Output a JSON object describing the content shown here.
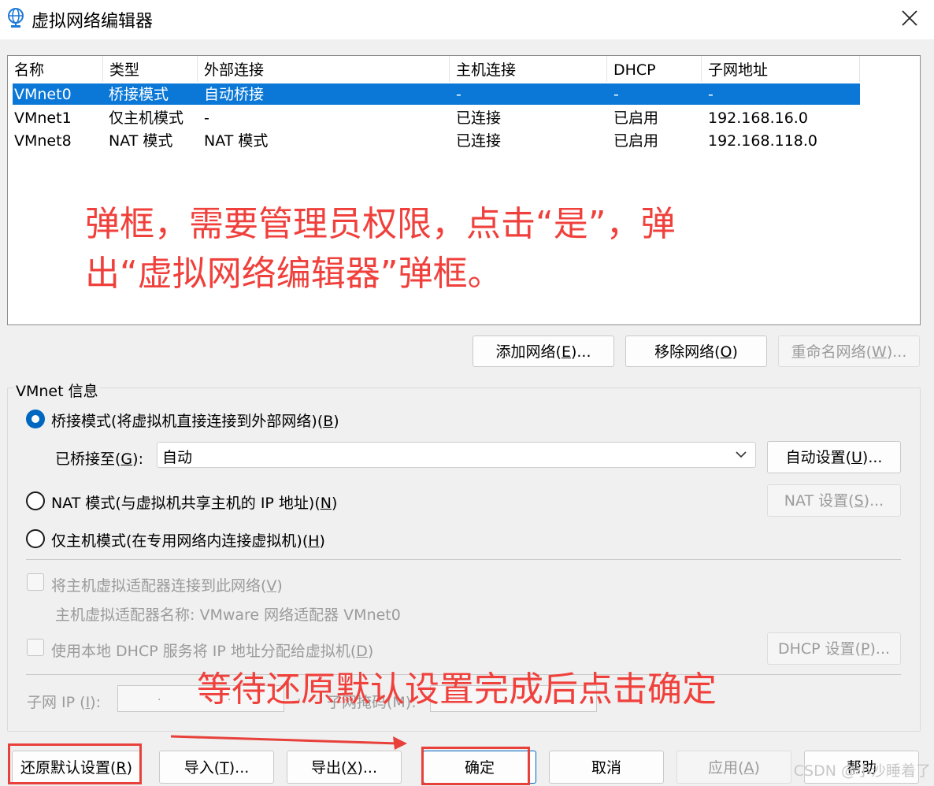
{
  "window": {
    "title": "虚拟网络编辑器",
    "close_icon": "close-icon",
    "app_icon": "globe-network-icon"
  },
  "table": {
    "headers": [
      "名称",
      "类型",
      "外部连接",
      "主机连接",
      "DHCP",
      "子网地址"
    ],
    "rows": [
      {
        "name": "VMnet0",
        "type": "桥接模式",
        "external": "自动桥接",
        "host": "-",
        "dhcp": "-",
        "subnet": "-",
        "selected": true
      },
      {
        "name": "VMnet1",
        "type": "仅主机模式",
        "external": "-",
        "host": "已连接",
        "dhcp": "已启用",
        "subnet": "192.168.16.0",
        "selected": false
      },
      {
        "name": "VMnet8",
        "type": "NAT 模式",
        "external": "NAT 模式",
        "host": "已连接",
        "dhcp": "已启用",
        "subnet": "192.168.118.0",
        "selected": false
      }
    ]
  },
  "annotations": {
    "top_line1": "弹框，需要管理员权限，点击“是”，弹",
    "top_line2": "出“虚拟网络编辑器”弹框。",
    "bottom": "等待还原默认设置完成后点击确定"
  },
  "network_buttons": {
    "add": {
      "text": "添加网络(",
      "key": "E",
      "suffix": ")..."
    },
    "remove": {
      "text": "移除网络(",
      "key": "O",
      "suffix": ")"
    },
    "rename": {
      "text": "重命名网络(",
      "key": "W",
      "suffix": ")..."
    }
  },
  "vmnet_info": {
    "title": "VMnet 信息",
    "bridged": {
      "text": "桥接模式(将虚拟机直接连接到外部网络)(",
      "key": "B",
      "suffix": ")",
      "checked": true
    },
    "bridged_to_label": {
      "text": "已桥接至(",
      "key": "G",
      "suffix": "):"
    },
    "bridged_to_value": "自动",
    "auto_settings": {
      "text": "自动设置(",
      "key": "U",
      "suffix": ")..."
    },
    "nat": {
      "text": "NAT 模式(与虚拟机共享主机的 IP 地址)(",
      "key": "N",
      "suffix": ")",
      "checked": false
    },
    "nat_settings": {
      "text": "NAT 设置(",
      "key": "S",
      "suffix": ")..."
    },
    "host_only": {
      "text": "仅主机模式(在专用网络内连接虚拟机)(",
      "key": "H",
      "suffix": ")",
      "checked": false
    },
    "connect_adapter": {
      "text": "将主机虚拟适配器连接到此网络(",
      "key": "V",
      "suffix": ")"
    },
    "adapter_name": "主机虚拟适配器名称: VMware 网络适配器 VMnet0",
    "use_dhcp": {
      "text": "使用本地 DHCP 服务将 IP 地址分配给虚拟机(",
      "key": "D",
      "suffix": ")"
    },
    "dhcp_settings": {
      "text": "DHCP 设置(",
      "key": "P",
      "suffix": ")..."
    },
    "subnet_ip": {
      "text": "子网 IP (",
      "key": "I",
      "suffix": "):"
    },
    "subnet_ip_value": ". . .",
    "subnet_mask": "子网掩码(M):"
  },
  "footer": {
    "restore": {
      "text": "还原默认设置(",
      "key": "R",
      "suffix": ")"
    },
    "import": {
      "text": "导入(",
      "key": "T",
      "suffix": ")..."
    },
    "export": {
      "text": "导出(",
      "key": "X",
      "suffix": ")..."
    },
    "ok": "确定",
    "cancel": "取消",
    "apply": {
      "text": "应用(",
      "key": "A",
      "suffix": ")"
    },
    "help": "帮助"
  },
  "watermark": "CSDN @小沙睡着了",
  "colors": {
    "selection": "#0b78d7",
    "annotation": "#f0403c",
    "accent": "#0067c0"
  }
}
